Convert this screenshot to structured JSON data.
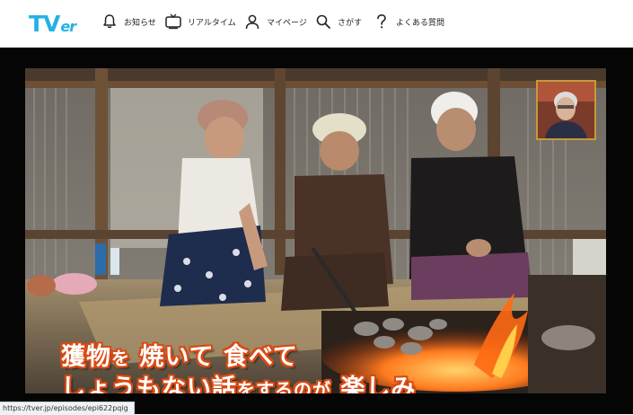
{
  "app": {
    "logo_main": "TV",
    "logo_sub": "er"
  },
  "nav": [
    {
      "label": "お知らせ",
      "icon": "bell-icon"
    },
    {
      "label": "リアルタイム",
      "icon": "tv-icon"
    },
    {
      "label": "マイページ",
      "icon": "user-icon"
    },
    {
      "label": "さがす",
      "icon": "search-icon"
    },
    {
      "label": "よくある質問",
      "icon": "question-icon"
    }
  ],
  "video": {
    "caption_line1_a": "獲物",
    "caption_line1_b": "を",
    "caption_line1_c": "焼いて 食べて",
    "caption_line2_a": "しょうもない話",
    "caption_line2_b": "を",
    "caption_line2_c": "するのが",
    "caption_line2_d": "楽しみ"
  },
  "status": {
    "url": "https://tver.jp/episodes/epi622pqig"
  },
  "colors": {
    "brand": "#23b1e6",
    "caption_outline": "#d84a14",
    "player_bg": "#050505"
  }
}
